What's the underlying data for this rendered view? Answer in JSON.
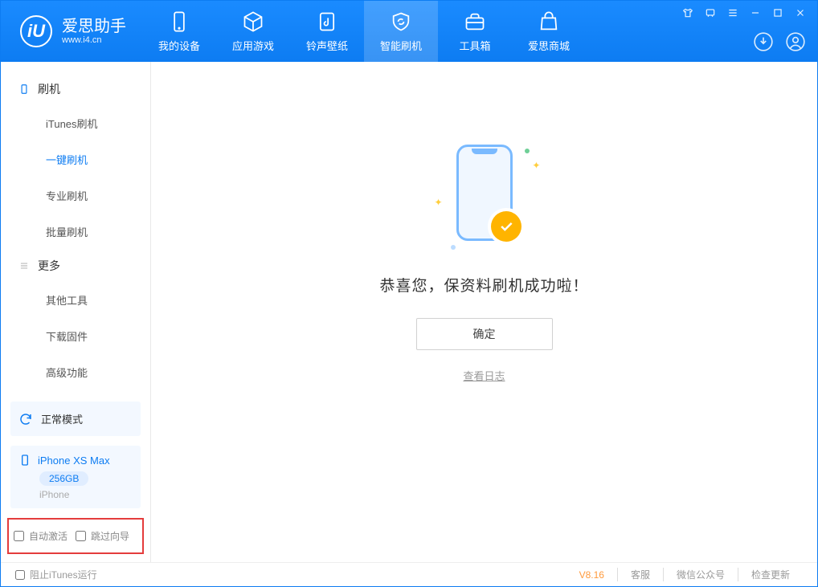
{
  "brand": {
    "name": "爱思助手",
    "url": "www.i4.cn",
    "logo_letter": "iU"
  },
  "nav": {
    "my_device": "我的设备",
    "apps_games": "应用游戏",
    "ring_wall": "铃声壁纸",
    "smart_flash": "智能刷机",
    "toolbox": "工具箱",
    "store": "爱思商城"
  },
  "sidebar": {
    "group_flash": "刷机",
    "items_flash": {
      "itunes_flash": "iTunes刷机",
      "one_key_flash": "一键刷机",
      "pro_flash": "专业刷机",
      "batch_flash": "批量刷机"
    },
    "group_more": "更多",
    "items_more": {
      "other_tools": "其他工具",
      "download_fw": "下载固件",
      "advanced": "高级功能"
    }
  },
  "mode": {
    "label": "正常模式"
  },
  "device": {
    "name": "iPhone XS Max",
    "storage": "256GB",
    "type": "iPhone"
  },
  "options": {
    "auto_activate": "自动激活",
    "skip_guide": "跳过向导"
  },
  "success": {
    "message": "恭喜您，保资料刷机成功啦！",
    "ok": "确定",
    "view_log": "查看日志"
  },
  "status": {
    "block_itunes": "阻止iTunes运行",
    "version": "V8.16",
    "support": "客服",
    "wechat": "微信公众号",
    "update": "检查更新"
  }
}
